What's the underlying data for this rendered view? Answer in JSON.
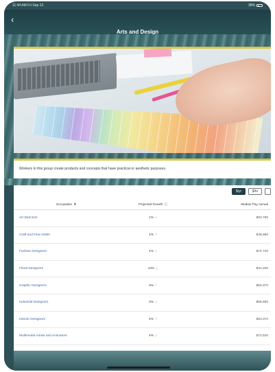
{
  "status": {
    "time": "11:44 AM  Fri Sep 13",
    "battery": "38%"
  },
  "nav": {
    "title": "Arts and Design",
    "back_glyph": "‹"
  },
  "hero": {
    "image": "artist-drawing-with-color-swatches"
  },
  "description": "Workers in this group create products and concepts that have practical or aesthetic purposes.",
  "pay_buttons": [
    "$/yr",
    "$/hr",
    ""
  ],
  "table": {
    "columns": {
      "occupation": "Occupation",
      "growth": "Projected Growth",
      "pay": "Median Pay Annual"
    },
    "rows": [
      {
        "occupation": "Art Directors",
        "growth": "1%",
        "trend": "up",
        "pay": "$93,780"
      },
      {
        "occupation": "Craft and Fine Artists",
        "growth": "1%",
        "trend": "up",
        "pay": "$48,960"
      },
      {
        "occupation": "Fashion Designers",
        "growth": "1%",
        "trend": "up",
        "pay": "$72,720"
      },
      {
        "occupation": "Floral Designers",
        "growth": "14%",
        "trend": "down",
        "pay": "$31,200"
      },
      {
        "occupation": "Graphic Designers",
        "growth": "3%",
        "trend": "up",
        "pay": "$50,370"
      },
      {
        "occupation": "Industrial Designers",
        "growth": "3%",
        "trend": "up",
        "pay": "$66,590"
      },
      {
        "occupation": "Interior Designers",
        "growth": "4%",
        "trend": "up",
        "pay": "$53,370"
      },
      {
        "occupation": "Multimedia Artists and Animators",
        "growth": "4%",
        "trend": "up",
        "pay": "$72,520"
      }
    ]
  },
  "colors": {
    "header": "#1f3f45",
    "accent": "#d8c64a",
    "link": "#3a66a0",
    "up": "#3aa05a",
    "down": "#cc3b3b"
  }
}
